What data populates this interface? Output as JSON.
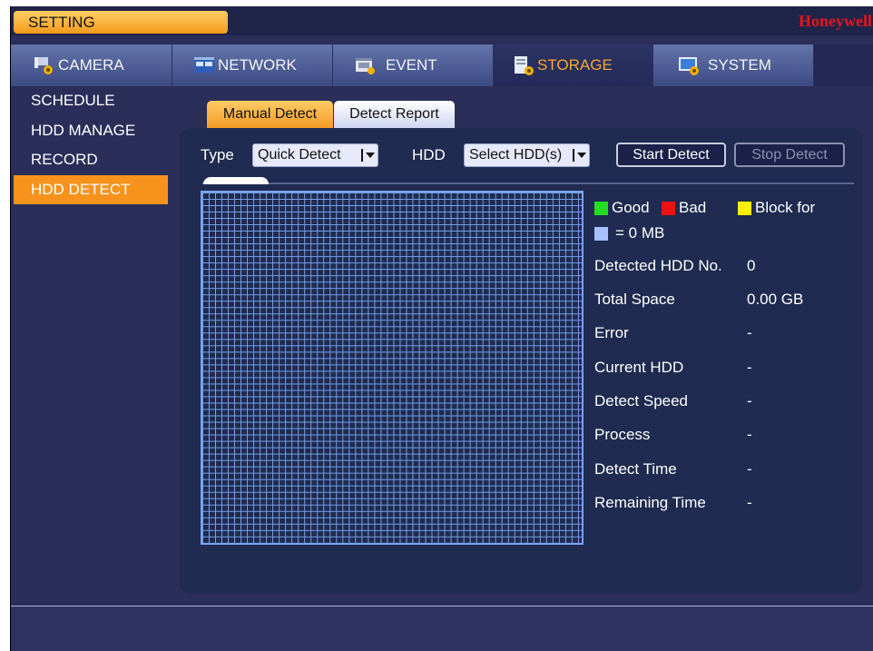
{
  "window": {
    "title": "SETTING",
    "brand": "Honeywell"
  },
  "main_tabs": [
    {
      "label": "CAMERA",
      "icon": "camera-icon",
      "active": false
    },
    {
      "label": "NETWORK",
      "icon": "network-icon",
      "active": false
    },
    {
      "label": "EVENT",
      "icon": "event-icon",
      "active": false
    },
    {
      "label": "STORAGE",
      "icon": "storage-icon",
      "active": true
    },
    {
      "label": "SYSTEM",
      "icon": "system-icon",
      "active": false
    }
  ],
  "sidebar": {
    "items": [
      {
        "label": "SCHEDULE",
        "active": false
      },
      {
        "label": "HDD MANAGE",
        "active": false
      },
      {
        "label": "RECORD",
        "active": false
      },
      {
        "label": "HDD DETECT",
        "active": true
      }
    ]
  },
  "sub_tabs": [
    {
      "label": "Manual Detect",
      "active": true
    },
    {
      "label": "Detect Report",
      "active": false
    }
  ],
  "controls": {
    "type_label": "Type",
    "type_value": "Quick Detect",
    "hdd_label": "HDD",
    "hdd_value": "Select HDD(s)",
    "start_label": "Start Detect",
    "stop_label": "Stop Detect"
  },
  "legend": {
    "good": "Good",
    "bad": "Bad",
    "block_for": "Block for",
    "block_size": "= 0 MB",
    "colors": {
      "good": "#22dd22",
      "bad": "#ee1111",
      "block_for": "#ffee00",
      "block_size": "#a8c0ff"
    }
  },
  "info": {
    "detected_hdd_no_label": "Detected HDD No.",
    "detected_hdd_no_value": "0",
    "total_space_label": "Total Space",
    "total_space_value": "0.00 GB",
    "error_label": "Error",
    "error_value": "-",
    "current_hdd_label": "Current HDD",
    "current_hdd_value": "-",
    "detect_speed_label": "Detect Speed",
    "detect_speed_value": "-",
    "process_label": "Process",
    "process_value": "-",
    "detect_time_label": "Detect Time",
    "detect_time_value": "-",
    "remaining_time_label": "Remaining Time",
    "remaining_time_value": "-"
  }
}
